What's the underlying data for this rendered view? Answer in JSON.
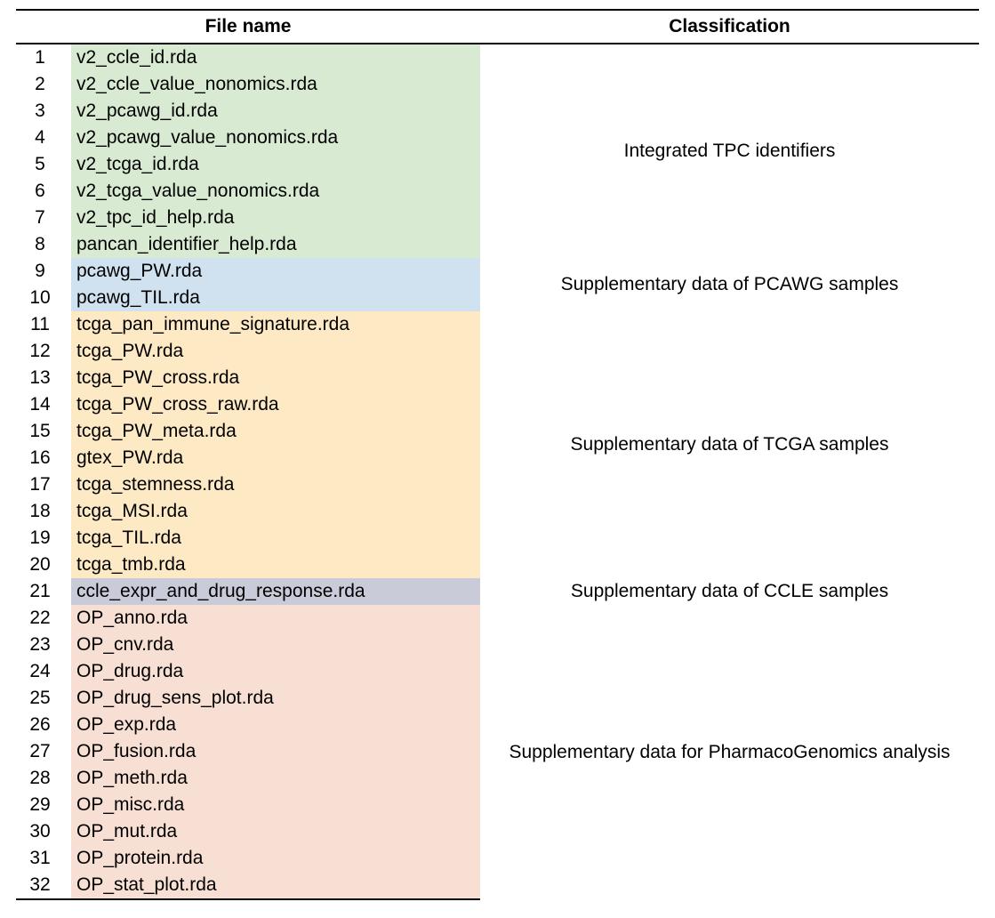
{
  "headers": {
    "filename": "File name",
    "classification": "Classification"
  },
  "groups": [
    {
      "bgClass": "bg-green",
      "classification": "Integrated TPC identifiers",
      "rows": [
        {
          "n": "1",
          "file": "v2_ccle_id.rda"
        },
        {
          "n": "2",
          "file": "v2_ccle_value_nonomics.rda"
        },
        {
          "n": "3",
          "file": "v2_pcawg_id.rda"
        },
        {
          "n": "4",
          "file": "v2_pcawg_value_nonomics.rda"
        },
        {
          "n": "5",
          "file": "v2_tcga_id.rda"
        },
        {
          "n": "6",
          "file": "v2_tcga_value_nonomics.rda"
        },
        {
          "n": "7",
          "file": "v2_tpc_id_help.rda"
        },
        {
          "n": "8",
          "file": "pancan_identifier_help.rda"
        }
      ]
    },
    {
      "bgClass": "bg-blue",
      "classification": "Supplementary data of PCAWG samples",
      "rows": [
        {
          "n": "9",
          "file": "pcawg_PW.rda"
        },
        {
          "n": "10",
          "file": "pcawg_TIL.rda"
        }
      ]
    },
    {
      "bgClass": "bg-yellow",
      "classification": "Supplementary data of TCGA  samples",
      "rows": [
        {
          "n": "11",
          "file": "tcga_pan_immune_signature.rda"
        },
        {
          "n": "12",
          "file": "tcga_PW.rda"
        },
        {
          "n": "13",
          "file": "tcga_PW_cross.rda"
        },
        {
          "n": "14",
          "file": "tcga_PW_cross_raw.rda"
        },
        {
          "n": "15",
          "file": "tcga_PW_meta.rda"
        },
        {
          "n": "16",
          "file": "gtex_PW.rda"
        },
        {
          "n": "17",
          "file": "tcga_stemness.rda"
        },
        {
          "n": "18",
          "file": "tcga_MSI.rda"
        },
        {
          "n": "19",
          "file": "tcga_TIL.rda"
        },
        {
          "n": "20",
          "file": "tcga_tmb.rda"
        }
      ]
    },
    {
      "bgClass": "bg-gray",
      "classification": "Supplementary data of CCLE  samples",
      "rows": [
        {
          "n": "21",
          "file": "ccle_expr_and_drug_response.rda"
        }
      ]
    },
    {
      "bgClass": "bg-pink",
      "classification": "Supplementary data for PharmacoGenomics analysis",
      "rows": [
        {
          "n": "22",
          "file": "OP_anno.rda"
        },
        {
          "n": "23",
          "file": "OP_cnv.rda"
        },
        {
          "n": "24",
          "file": "OP_drug.rda"
        },
        {
          "n": "25",
          "file": "OP_drug_sens_plot.rda"
        },
        {
          "n": "26",
          "file": "OP_exp.rda"
        },
        {
          "n": "27",
          "file": "OP_fusion.rda"
        },
        {
          "n": "28",
          "file": "OP_meth.rda"
        },
        {
          "n": "29",
          "file": "OP_misc.rda"
        },
        {
          "n": "30",
          "file": "OP_mut.rda"
        },
        {
          "n": "31",
          "file": "OP_protein.rda"
        },
        {
          "n": "32",
          "file": "OP_stat_plot.rda"
        }
      ]
    }
  ]
}
